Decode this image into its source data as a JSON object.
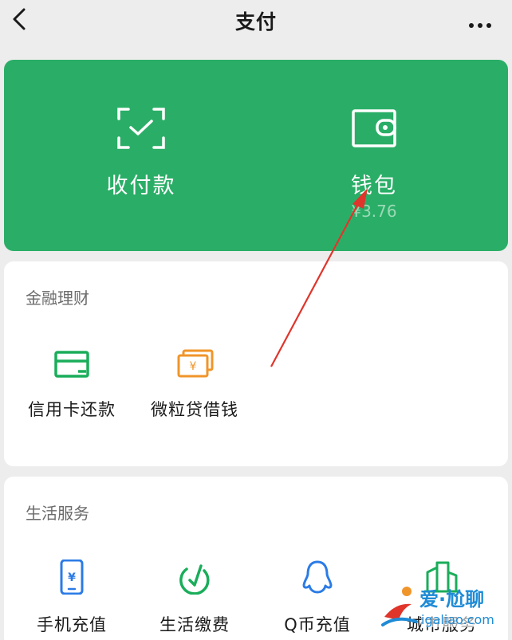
{
  "header": {
    "title": "支付"
  },
  "wallet_card": {
    "receive_pay": {
      "label": "收付款",
      "icon": "scan-check-icon"
    },
    "wallet": {
      "label": "钱包",
      "balance": "¥3.76",
      "icon": "wallet-icon"
    }
  },
  "finance": {
    "title": "金融理财",
    "items": [
      {
        "label": "信用卡还款",
        "icon": "credit-card-icon",
        "color": "#1aad5a"
      },
      {
        "label": "微粒贷借钱",
        "icon": "cash-notes-icon",
        "color": "#f0952a"
      }
    ]
  },
  "life": {
    "title": "生活服务",
    "items": [
      {
        "label": "手机充值",
        "icon": "phone-icon",
        "color": "#2b7be6"
      },
      {
        "label": "生活缴费",
        "icon": "leaf-check-icon",
        "color": "#1aad5a"
      },
      {
        "label": "Q币充值",
        "icon": "penguin-icon",
        "color": "#2b7be6"
      },
      {
        "label": "城市服务",
        "icon": "city-buildings-icon",
        "color": "#1aad5a"
      }
    ]
  },
  "watermark": {
    "brand": "爱·尬聊",
    "url": "igaliao.com"
  },
  "colors": {
    "accent_green": "#2aae67",
    "annotation_arrow": "#e0352b"
  }
}
